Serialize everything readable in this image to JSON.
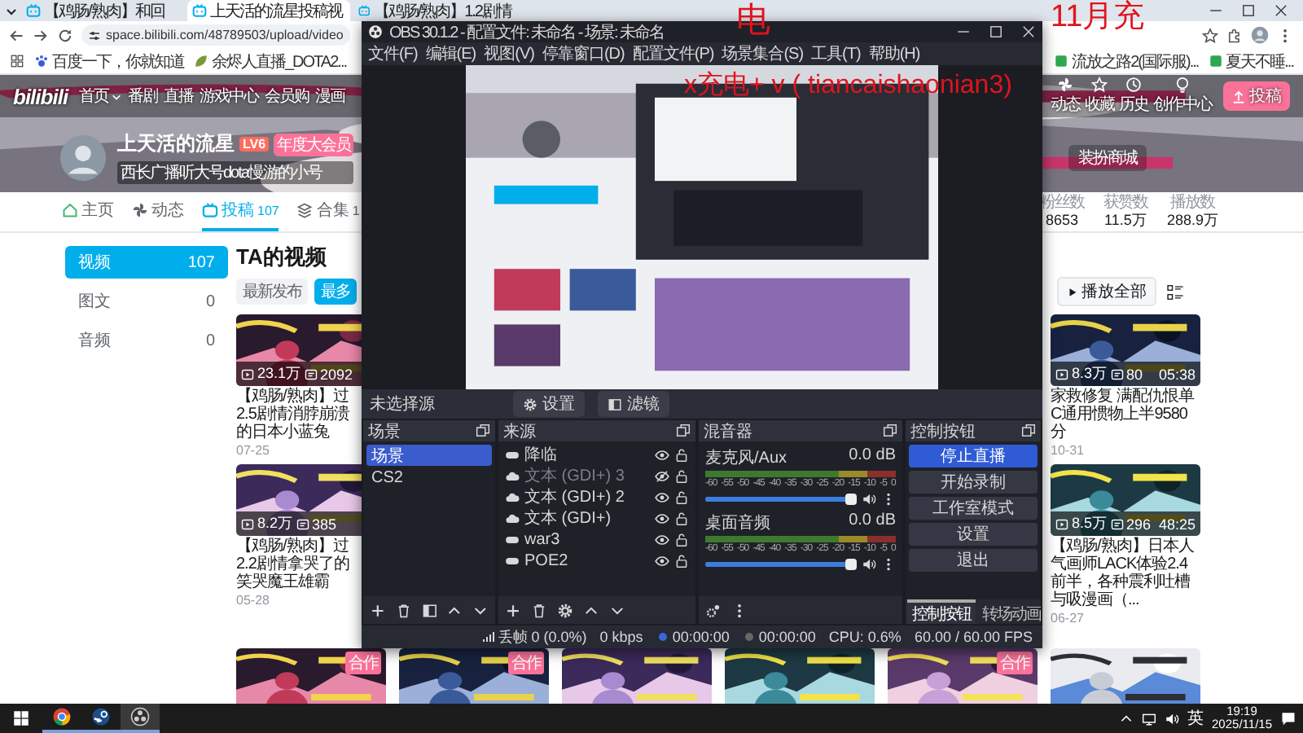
{
  "browser": {
    "tabs": [
      {
        "title": "【鸡肠/熟肉】和回",
        "selected": false
      },
      {
        "title": "上天活的流星投稿视",
        "selected": true
      },
      {
        "title": "【鸡肠/熟肉】1.2剧情",
        "selected": false
      }
    ],
    "address": "space.bilibili.com/48789503/upload/video",
    "bookmarks": [
      {
        "label": "百度一下，你就知道",
        "kind": "paw"
      },
      {
        "label": "余烬人直播_DOTA2...",
        "kind": "leaf"
      }
    ],
    "bookmarks_right": [
      {
        "label": "流放之路2(国际服)...",
        "kind": "square"
      },
      {
        "label": "夏天不睡...",
        "kind": "square"
      }
    ]
  },
  "bili": {
    "logo": "bilibili",
    "nav": [
      {
        "label": "首页",
        "has_menu": true
      },
      {
        "label": "番剧",
        "has_menu": false
      },
      {
        "label": "直播",
        "has_menu": false
      },
      {
        "label": "游戏中心",
        "has_menu": false
      },
      {
        "label": "会员购",
        "has_menu": false
      },
      {
        "label": "漫画",
        "has_menu": false
      }
    ],
    "nav_right": [
      {
        "label": "动态",
        "kind": "dynamic"
      },
      {
        "label": "收藏",
        "kind": "favorite"
      },
      {
        "label": "历史",
        "kind": "history"
      },
      {
        "label": "创作中心",
        "kind": "creator"
      }
    ],
    "upload": "投稿",
    "profile": {
      "name": "上天活的流星",
      "level": "LV6",
      "vip": "年度大会员",
      "sign": "西长广播听大号dota慢游的小号"
    },
    "banner_button": "装扮商城",
    "tabs": [
      {
        "label": "主页",
        "kind": "home",
        "selected": false
      },
      {
        "label": "动态",
        "kind": "dynamic",
        "selected": false
      },
      {
        "label": "投稿",
        "kind": "upload",
        "count": "107",
        "selected": true
      },
      {
        "label": "合集",
        "kind": "collection",
        "count": "1",
        "selected": false
      }
    ],
    "stats": [
      {
        "label": "粉丝数",
        "value": "8653"
      },
      {
        "label": "获赞数",
        "value": "11.5万"
      },
      {
        "label": "播放数",
        "value": "288.9万"
      }
    ],
    "sidebar": [
      {
        "label": "视频",
        "count": "107",
        "selected": true
      },
      {
        "label": "图文",
        "count": "0",
        "selected": false
      },
      {
        "label": "音频",
        "count": "0",
        "selected": false
      }
    ],
    "heading": "TA的视频",
    "sort": [
      {
        "label": "最新发布",
        "selected": false
      },
      {
        "label": "最多",
        "selected": true
      }
    ],
    "play_all": "播放全部",
    "videos_left": [
      {
        "views": "23.1万",
        "danmaku": "2092",
        "title": "【鸡肠/熟肉】过2.5剧情消脖崩溃的日本小蓝兔",
        "date": "07-25"
      },
      {
        "views": "8.2万",
        "danmaku": "385",
        "title": "【鸡肠/熟肉】过2.2剧情拿哭了的笑哭魔王雄霸",
        "date": "05-28"
      }
    ],
    "videos_right": [
      {
        "views": "8.3万",
        "danmaku": "80",
        "duration": "05:38",
        "title": "家救修复 满配仇恨单C通用惯物上半9580分",
        "date": "10-31"
      },
      {
        "views": "8.5万",
        "danmaku": "296",
        "duration": "48:25",
        "title": "【鸡肠/熟肉】日本人气画师LACK体验2.4前半，各种震利吐槽与吸漫画（...",
        "date": "06-27"
      }
    ],
    "more_thumbnails": [
      {
        "kind": "picture",
        "badge": "合作"
      },
      {
        "kind": "picture",
        "badge": "合作"
      },
      {
        "kind": "picture"
      },
      {
        "kind": "picture"
      },
      {
        "kind": "picture",
        "badge": "合作"
      },
      {
        "kind": "picture"
      }
    ]
  },
  "obs": {
    "title": "OBS 30.1.2 - 配置文件: 未命名 - 场景: 未命名",
    "menu": [
      "文件(F)",
      "编辑(E)",
      "视图(V)",
      "停靠窗口(D)",
      "配置文件(P)",
      "场景集合(S)",
      "工具(T)",
      "帮助(H)"
    ],
    "preview": {
      "kind": "picture"
    },
    "source_status": "未选择源",
    "source_buttons": [
      {
        "label": "设置",
        "kind": "settings"
      },
      {
        "label": "滤镜",
        "kind": "filters"
      }
    ],
    "scenes": {
      "title": "场景",
      "items": [
        {
          "name": "场景",
          "selected": true
        },
        {
          "name": "CS2",
          "selected": false
        }
      ]
    },
    "sources": {
      "title": "来源",
      "items": [
        {
          "name": "降临",
          "kind": "game",
          "visible": true
        },
        {
          "name": "文本 (GDI+) 3",
          "kind": "text",
          "visible": false
        },
        {
          "name": "文本 (GDI+) 2",
          "kind": "text",
          "visible": true
        },
        {
          "name": "文本 (GDI+)",
          "kind": "text",
          "visible": true
        },
        {
          "name": "war3",
          "kind": "game",
          "visible": true
        },
        {
          "name": "POE2",
          "kind": "game",
          "visible": true
        }
      ]
    },
    "mixer": {
      "title": "混音器",
      "channels": [
        {
          "name": "麦克风/Aux",
          "reading": "0.0 dB",
          "scale": [
            "-60",
            "-55",
            "-50",
            "-45",
            "-40",
            "-35",
            "-30",
            "-25",
            "-20",
            "-15",
            "-10",
            "-5",
            "0"
          ],
          "level": 0.96
        },
        {
          "name": "桌面音频",
          "reading": "0.0 dB",
          "scale": [
            "-60",
            "-55",
            "-50",
            "-45",
            "-40",
            "-35",
            "-30",
            "-25",
            "-20",
            "-15",
            "-10",
            "-5",
            "0"
          ],
          "level": 0.96
        }
      ]
    },
    "controls": {
      "title": "控制按钮",
      "buttons": [
        {
          "label": "停止直播",
          "selected": true
        },
        {
          "label": "开始录制",
          "selected": false
        },
        {
          "label": "工作室模式",
          "selected": false
        },
        {
          "label": "设置",
          "selected": false
        },
        {
          "label": "退出",
          "selected": false
        }
      ],
      "tabs": [
        {
          "label": "控制按钮",
          "selected": true
        },
        {
          "label": "转场动画",
          "selected": false
        }
      ]
    },
    "status": [
      {
        "kind": "dropped",
        "text": "丢帧 0 (0.0%)"
      },
      {
        "kind": "bitrate",
        "text": "0 kbps"
      },
      {
        "kind": "stream",
        "text": "00:00:00"
      },
      {
        "kind": "record",
        "text": "00:00:00"
      },
      {
        "kind": "cpu",
        "text": "CPU: 0.6%"
      },
      {
        "kind": "fps",
        "text": "60.00 / 60.00 FPS"
      }
    ]
  },
  "overlay": [
    {
      "text": "电"
    },
    {
      "text": "11月充"
    },
    {
      "text": "x充电+ v ( tiancaishaonian3)"
    }
  ],
  "taskbar": {
    "apps": [
      {
        "kind": "chrome",
        "selected": false
      },
      {
        "kind": "steam",
        "selected": false
      },
      {
        "kind": "obs",
        "selected": true
      }
    ],
    "ime": "英",
    "time": "19:19",
    "date": "2025/11/15"
  }
}
